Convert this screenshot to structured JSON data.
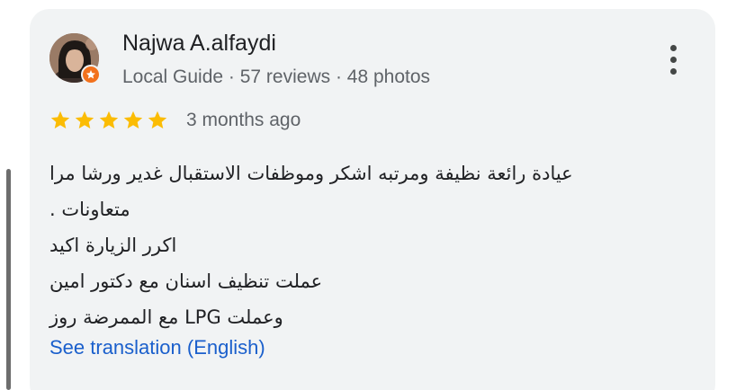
{
  "review": {
    "author": {
      "name": "Najwa A.alfaydi",
      "meta": "Local Guide · 57 reviews · 48 photos",
      "badge_icon": "local-guide-star-icon"
    },
    "rating": 5,
    "time": "3 months ago",
    "text_lines": [
      "عيادة رائعة نظيفة ومرتبه اشكر وموظفات الاستقبال غدير ورشا مرا",
      "متعاونات .",
      "اكرر الزيارة اكيد",
      "عملت تنظيف اسنان مع دكتور امين",
      "وعملت LPG مع الممرضة روز"
    ],
    "translate_label": "See translation (English)",
    "menu_icon": "more-vertical-icon"
  },
  "colors": {
    "card_bg": "#f1f3f4",
    "star": "#fbbc04",
    "link": "#1a5fcc",
    "badge": "#f2711c"
  }
}
